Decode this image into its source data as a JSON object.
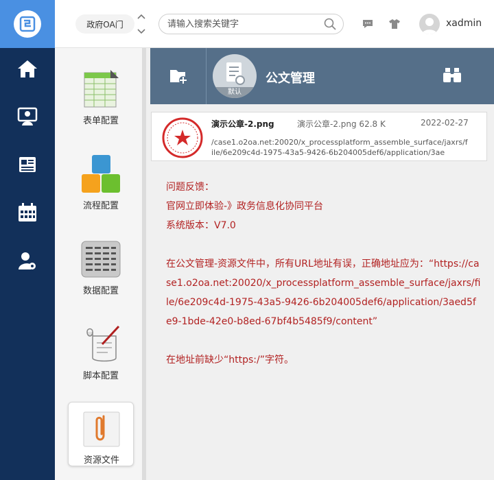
{
  "header": {
    "scope_label": "政府OA门",
    "search_placeholder": "请输入搜索关键字",
    "username": "xadmin"
  },
  "rail": {
    "items": [
      {
        "icon": "home-icon"
      },
      {
        "icon": "user-board-icon"
      },
      {
        "icon": "news-icon"
      },
      {
        "icon": "calendar-icon"
      },
      {
        "icon": "user-settings-icon"
      }
    ]
  },
  "modules": {
    "items": [
      {
        "label": "表单配置",
        "icon": "form-config-icon"
      },
      {
        "label": "流程配置",
        "icon": "process-config-icon"
      },
      {
        "label": "数据配置",
        "icon": "data-config-icon"
      },
      {
        "label": "脚本配置",
        "icon": "script-config-icon"
      },
      {
        "label": "资源文件",
        "icon": "resource-file-icon",
        "active": true
      }
    ]
  },
  "toolbar": {
    "app_title": "公文管理",
    "default_tag": "默认"
  },
  "file": {
    "name": "演示公章-2.png",
    "meta": "演示公章-2.png 62.8 K",
    "date": "2022-02-27",
    "url": "/case1.o2oa.net:20020/x_processplatform_assemble_surface/jaxrs/file/6e209c4d-1975-43a5-9426-6b204005def6/application/3ae"
  },
  "feedback": {
    "line1": "问题反馈：",
    "line2": "官网立即体验-》政务信息化协同平台",
    "line3": "系统版本：V7.0",
    "line4": "在公文管理-资源文件中，所有URL地址有误，正确地址应为：“https://case1.o2oa.net:20020/x_processplatform_assemble_surface/jaxrs/file/6e209c4d-1975-43a5-9426-6b204005def6/application/3aed5fe9-1bde-42e0-b8ed-67bf4b5485f9/content”",
    "line5": "在地址前缺少“https:/”字符。"
  },
  "colors": {
    "logo_bg": "#4a90e2",
    "rail_bg": "#12305a",
    "toolbar_bg": "#556f89",
    "feedback_text": "#b22222"
  }
}
